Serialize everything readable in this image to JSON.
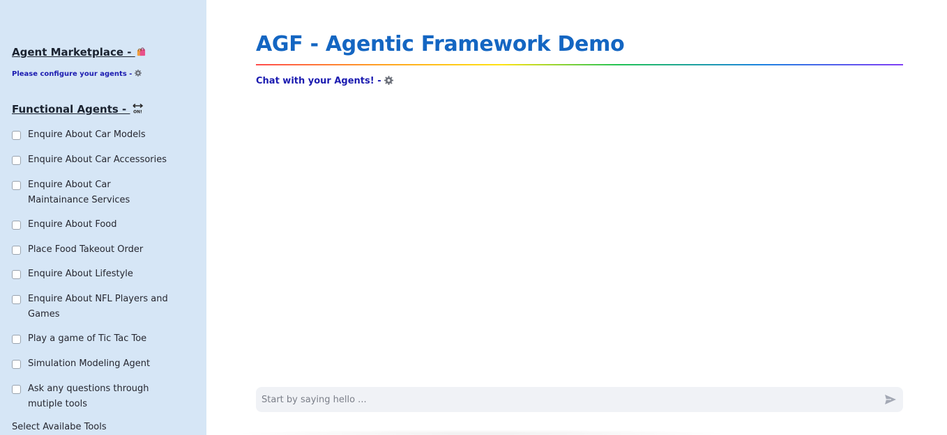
{
  "sidebar": {
    "title": "Agent Marketplace - ",
    "subtitle": "Please configure your agents - ",
    "functional_title": "Functional Agents - ",
    "agents": [
      {
        "label": "Enquire About Car Models",
        "checked": false
      },
      {
        "label": "Enquire About Car Accessories",
        "checked": false
      },
      {
        "label": "Enquire About Car Maintainance Services",
        "checked": false
      },
      {
        "label": "Enquire About Food",
        "checked": false
      },
      {
        "label": "Place Food Takeout Order",
        "checked": false
      },
      {
        "label": "Enquire About Lifestyle",
        "checked": false
      },
      {
        "label": "Enquire About NFL Players and Games",
        "checked": false
      },
      {
        "label": "Play a game of Tic Tac Toe",
        "checked": false
      },
      {
        "label": "Simulation Modeling Agent",
        "checked": false
      },
      {
        "label": "Ask any questions through mutiple tools",
        "checked": false
      }
    ],
    "tools_label": "Select Availabe Tools"
  },
  "main": {
    "title": "AGF - Agentic Framework Demo",
    "chat_link": "Chat with your Agents! - ",
    "chat_input": {
      "placeholder": "Start by saying hello ...",
      "value": ""
    }
  },
  "colors": {
    "sidebar_bg": "#d6e6f6",
    "title_blue": "#1466c2",
    "link_blue": "#1b1bb0",
    "input_bg": "#f0f2f6"
  },
  "icons": {
    "marketplace": "shopping-bags-icon",
    "configure": "gear-icon",
    "functional": "on-arrow-icon",
    "chat": "gear-icon",
    "send": "send-icon"
  }
}
